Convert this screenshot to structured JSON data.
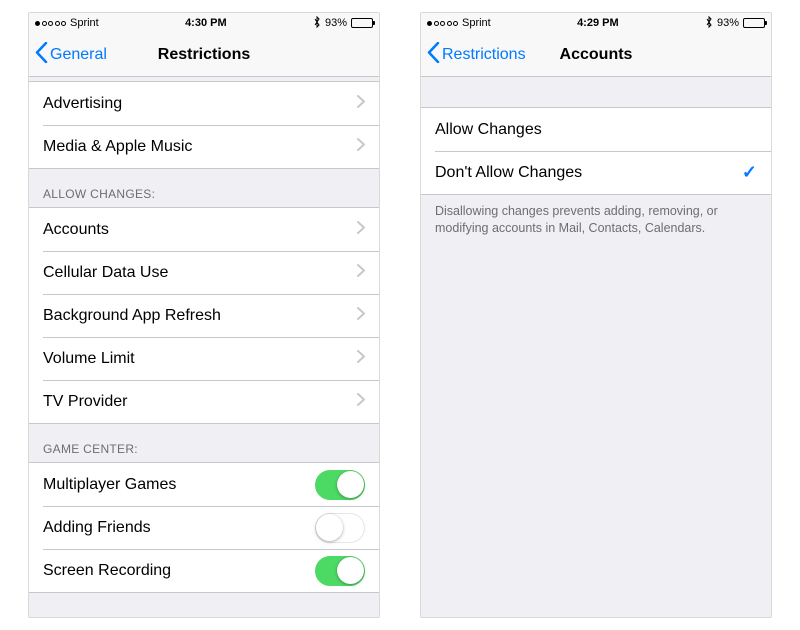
{
  "left": {
    "status": {
      "carrier": "Sprint",
      "time": "4:30 PM",
      "bt": "✱",
      "battery_pct": "93%",
      "battery_fill": 93,
      "signal_filled": 1
    },
    "nav": {
      "back": "General",
      "title": "Restrictions"
    },
    "group0": {
      "rows": [
        {
          "label": "Advertising"
        },
        {
          "label": "Media & Apple Music"
        }
      ]
    },
    "allow_changes": {
      "header": "ALLOW CHANGES:",
      "rows": [
        {
          "label": "Accounts"
        },
        {
          "label": "Cellular Data Use"
        },
        {
          "label": "Background App Refresh"
        },
        {
          "label": "Volume Limit"
        },
        {
          "label": "TV Provider"
        }
      ]
    },
    "game_center": {
      "header": "GAME CENTER:",
      "rows": [
        {
          "label": "Multiplayer Games",
          "on": true
        },
        {
          "label": "Adding Friends",
          "on": false
        },
        {
          "label": "Screen Recording",
          "on": true
        }
      ]
    }
  },
  "right": {
    "status": {
      "carrier": "Sprint",
      "time": "4:29 PM",
      "bt": "✱",
      "battery_pct": "93%",
      "battery_fill": 93,
      "signal_filled": 1
    },
    "nav": {
      "back": "Restrictions",
      "title": "Accounts"
    },
    "options": {
      "rows": [
        {
          "label": "Allow Changes",
          "selected": false
        },
        {
          "label": "Don't Allow Changes",
          "selected": true
        }
      ],
      "footer": "Disallowing changes prevents adding, removing, or modifying accounts in Mail, Contacts, Calendars."
    }
  }
}
